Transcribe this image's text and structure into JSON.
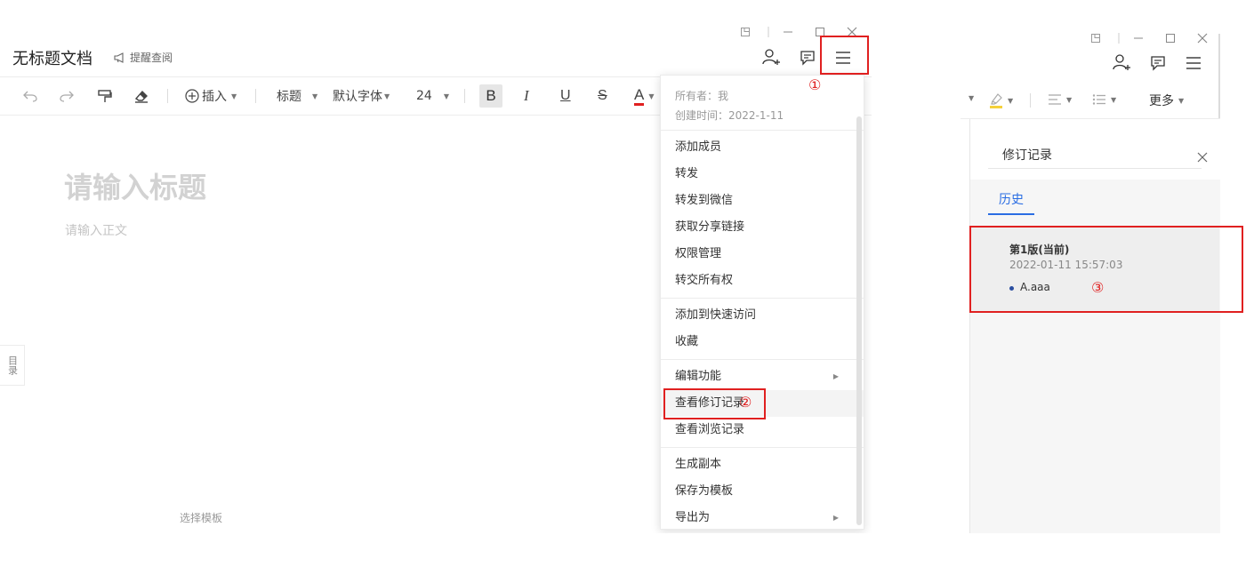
{
  "left": {
    "doc_title": "无标题文档",
    "remind_label": "提醒查阅",
    "toolbar": {
      "insert_label": "插入",
      "style_label": "标题",
      "font_label": "默认字体",
      "size_label": "24",
      "bold_label": "B",
      "italic_label": "I",
      "underline_label": "U",
      "strike_label": "S",
      "color_label": "A",
      "color_accent": "#e02020"
    },
    "title_placeholder": "请输入标题",
    "body_placeholder": "请输入正文",
    "toc_label": "目录",
    "template_label": "选择模板"
  },
  "menu": {
    "owner": "所有者：我",
    "created": "创建时间：2022-1-11",
    "groups": [
      [
        "添加成员",
        "转发",
        "转发到微信",
        "获取分享链接",
        "权限管理",
        "转交所有权"
      ],
      [
        "添加到快速访问",
        "收藏"
      ],
      [
        "编辑功能",
        "查看修订记录",
        "查看浏览记录"
      ],
      [
        "生成副本",
        "保存为模板",
        "导出为"
      ]
    ]
  },
  "annotations": {
    "one": "①",
    "two": "②",
    "three": "③",
    "color": "#e02020"
  },
  "right": {
    "more_label": "更多",
    "panel_title": "修订记录",
    "tab_label": "历史",
    "version": {
      "title": "第1版(当前)",
      "time": "2022-01-11 15:57:03",
      "user": "A.aaa"
    },
    "accent_color": "#2a6de3"
  }
}
